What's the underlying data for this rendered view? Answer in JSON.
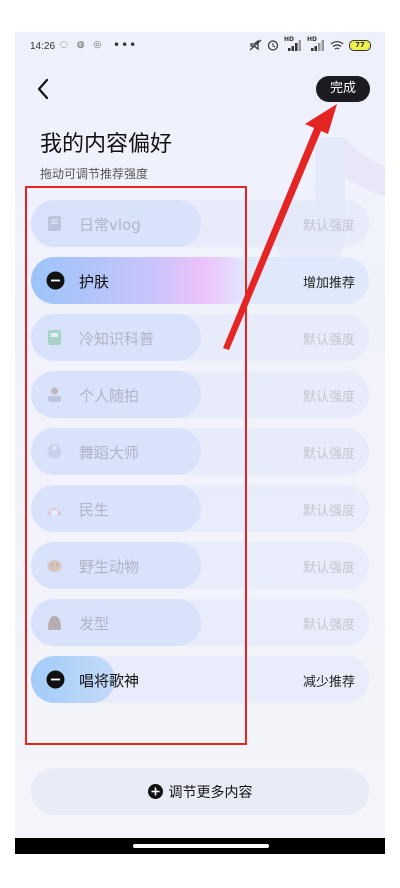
{
  "status": {
    "time": "14:26",
    "left_icons": [
      "notification-icon",
      "app-icon",
      "app-icon"
    ],
    "more": "•••",
    "right_icons": [
      "mute-icon",
      "alarm-icon",
      "signal-icon",
      "signal-icon",
      "wifi-icon"
    ],
    "hd1": "HD",
    "hd2": "HD",
    "battery": "77"
  },
  "header": {
    "back_icon": "chevron-left-icon",
    "done_label": "完成",
    "title": "我的内容偏好",
    "subtitle": "拖动可调节推荐强度"
  },
  "items": [
    {
      "label": "日常vlog",
      "strength": "默认强度",
      "icon": "notebook-icon",
      "state": "default"
    },
    {
      "label": "护肤",
      "strength": "增加推荐",
      "icon": "minus-circle-icon",
      "state": "increase"
    },
    {
      "label": "冷知识科普",
      "strength": "默认强度",
      "icon": "book-icon",
      "state": "default"
    },
    {
      "label": "个人随拍",
      "strength": "默认强度",
      "icon": "camera-person-icon",
      "state": "default"
    },
    {
      "label": "舞蹈大师",
      "strength": "默认强度",
      "icon": "dance-icon",
      "state": "default"
    },
    {
      "label": "民生",
      "strength": "默认强度",
      "icon": "community-icon",
      "state": "default"
    },
    {
      "label": "野生动物",
      "strength": "默认强度",
      "icon": "animal-icon",
      "state": "default"
    },
    {
      "label": "发型",
      "strength": "默认强度",
      "icon": "hairstyle-icon",
      "state": "default"
    },
    {
      "label": "唱将歌神",
      "strength": "减少推荐",
      "icon": "minus-circle-icon",
      "state": "decrease"
    }
  ],
  "more_button": {
    "label": "调节更多内容",
    "icon": "plus-circle-icon"
  },
  "annotations": {
    "box_color": "#e52424",
    "arrow_color": "#e52424"
  },
  "colors": {
    "done_bg": "#1b1c22",
    "accent_gradient": [
      "#9cc4f8",
      "#ecc2fb"
    ]
  }
}
